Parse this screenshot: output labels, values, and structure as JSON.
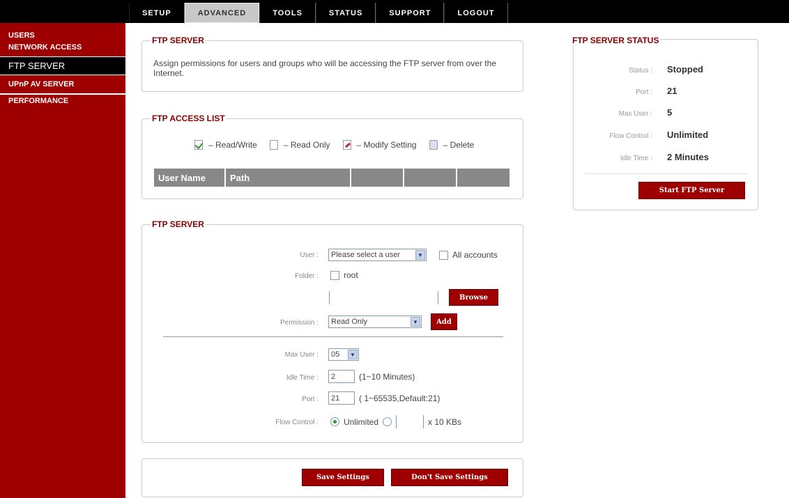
{
  "nav": {
    "items": [
      "SETUP",
      "ADVANCED",
      "TOOLS",
      "STATUS",
      "SUPPORT",
      "LOGOUT"
    ],
    "active": "ADVANCED"
  },
  "sidebar": {
    "items": [
      "USERS",
      "NETWORK ACCESS",
      "FTP SERVER",
      "UPnP AV SERVER",
      "PERFORMANCE"
    ]
  },
  "ftp_intro": {
    "title": "FTP SERVER",
    "description": "Assign permissions for users and groups who will be accessing the FTP server from over the Internet."
  },
  "access_list": {
    "title": "FTP ACCESS LIST",
    "legend": {
      "read_write": "– Read/Write",
      "read_only": "– Read Only",
      "modify": "– Modify Setting",
      "delete": "– Delete"
    },
    "columns": [
      "User Name",
      "Path",
      "",
      "",
      ""
    ]
  },
  "ftp_form": {
    "title": "FTP SERVER",
    "user_label": "User :",
    "user_value": "Please select a user",
    "all_accounts": "All accounts",
    "folder_label": "Folder :",
    "folder_value": "root",
    "browse_label": "Browse",
    "permission_label": "Permission :",
    "permission_value": "Read Only",
    "add_label": "Add",
    "max_user_label": "Max User :",
    "max_user_value": "05",
    "idle_label": "Idle Time :",
    "idle_value": "2",
    "idle_hint": "(1~10 Minutes)",
    "port_label": "Port :",
    "port_value": "21",
    "port_hint": "( 1~65535,Default:21)",
    "flow_label": "Flow Control :",
    "flow_unlimited": "Unlimited",
    "flow_unit": "x 10 KBs"
  },
  "actions": {
    "save": "Save Settings",
    "dont_save": "Don't Save Settings"
  },
  "status": {
    "title": "FTP SERVER STATUS",
    "status_label": "Status :",
    "status_value": "Stopped",
    "port_label": "Port :",
    "port_value": "21",
    "max_user_label": "Max User :",
    "max_user_value": "5",
    "flow_label": "Flow Control :",
    "flow_value": "Unlimited",
    "idle_label": "Idle Time :",
    "idle_value": "2 Minutes",
    "start_button": "Start FTP Server"
  }
}
